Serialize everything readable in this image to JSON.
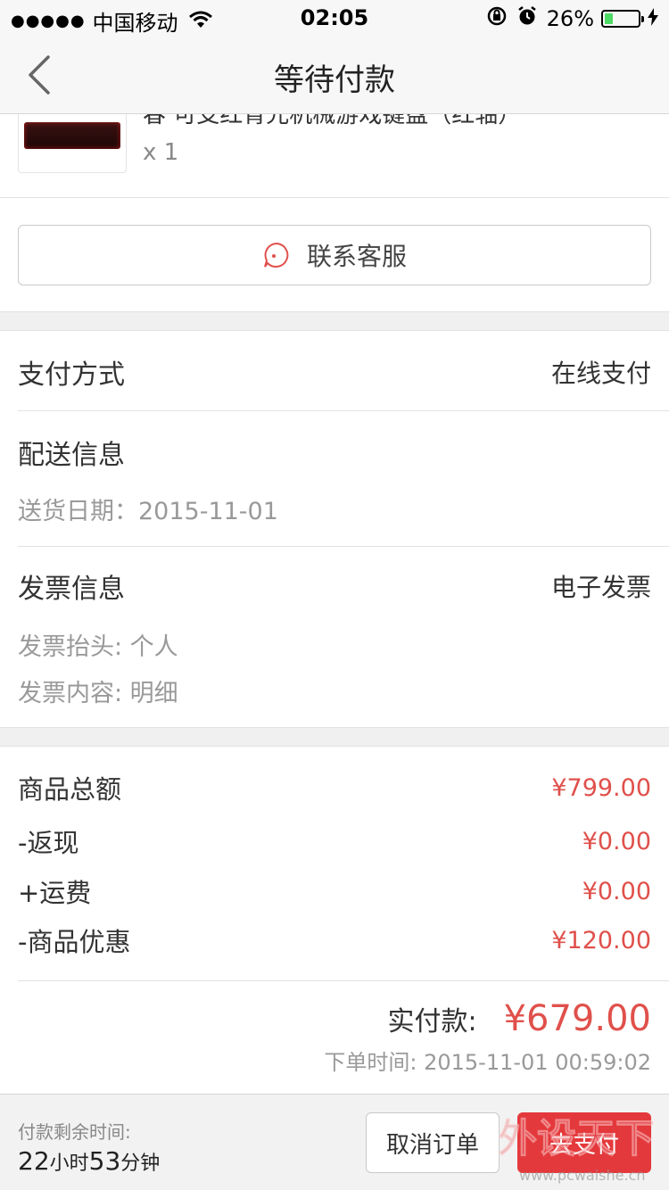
{
  "status_bar": {
    "carrier": "中国移动",
    "time": "02:05",
    "battery_percent": "26%",
    "battery_level": 0.26,
    "signal_icon": "signal-dots-icon",
    "wifi_icon": "wifi-icon",
    "lock_icon": "rotation-lock-icon",
    "alarm_icon": "alarm-icon",
    "charging_icon": "charging-bolt-icon"
  },
  "nav": {
    "title": "等待付款",
    "back_icon": "back-chevron-icon"
  },
  "product": {
    "name": "春 可支红背光机械游戏键盘（红轴）",
    "quantity": "x 1"
  },
  "service": {
    "label": "联系客服",
    "icon": "customer-service-icon"
  },
  "payment": {
    "label": "支付方式",
    "value": "在线支付"
  },
  "delivery": {
    "label": "配送信息",
    "date_line": "送货日期：2015-11-01"
  },
  "invoice": {
    "label": "发票信息",
    "value": "电子发票",
    "title_line": "发票抬头: 个人",
    "content_line": "发票内容: 明细"
  },
  "amounts": [
    {
      "label": "商品总额",
      "value": "¥799.00"
    },
    {
      "label": "-返现",
      "value": "¥0.00"
    },
    {
      "label": "+运费",
      "value": "¥0.00"
    },
    {
      "label": "-商品优惠",
      "value": "¥120.00"
    }
  ],
  "total": {
    "label": "实付款:",
    "value": "¥679.00",
    "order_time": "下单时间: 2015-11-01 00:59:02"
  },
  "footer": {
    "remaining_label": "付款剩余时间:",
    "hours": "22",
    "hours_unit": "小时",
    "minutes": "53",
    "minutes_unit": "分钟",
    "cancel_label": "取消订单",
    "pay_label": "去支付"
  },
  "watermark": {
    "text": "外设天下",
    "url": "www.pcwaishe.cn"
  },
  "colors": {
    "accent_red": "#e4393c",
    "price_red": "#e0504b",
    "battery_green": "#4cd964"
  }
}
